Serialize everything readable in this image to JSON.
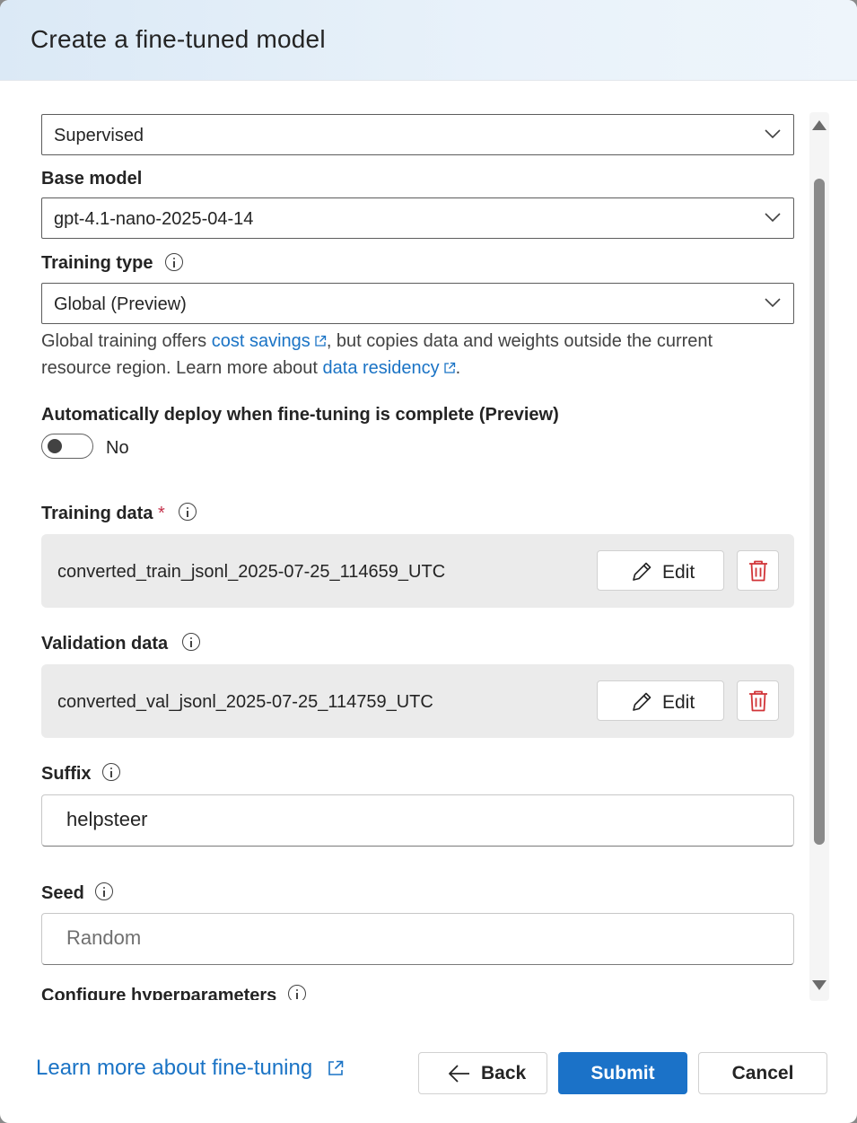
{
  "dialog": {
    "title": "Create a fine-tuned model"
  },
  "method": {
    "value": "Supervised"
  },
  "base_model": {
    "label": "Base model",
    "value": "gpt-4.1-nano-2025-04-14"
  },
  "training_type": {
    "label": "Training type",
    "value": "Global (Preview)",
    "help_before": "Global training offers ",
    "help_link1": "cost savings",
    "help_middle": ", but copies data and weights outside the current resource region. Learn more about ",
    "help_link2": "data residency",
    "help_end": "."
  },
  "auto_deploy": {
    "label": "Automatically deploy when fine-tuning is complete (Preview)",
    "state_label": "No"
  },
  "training_data": {
    "label": "Training data",
    "required_mark": "*",
    "file": "converted_train_jsonl_2025-07-25_114659_UTC",
    "edit_label": "Edit"
  },
  "validation_data": {
    "label": "Validation data",
    "file": "converted_val_jsonl_2025-07-25_114759_UTC",
    "edit_label": "Edit"
  },
  "suffix": {
    "label": "Suffix",
    "value": "helpsteer"
  },
  "seed": {
    "label": "Seed",
    "placeholder": "Random"
  },
  "hyperparameters": {
    "label": "Configure hyperparameters"
  },
  "footer": {
    "learn_more": "Learn more about fine-tuning",
    "back_label": "Back",
    "submit_label": "Submit",
    "cancel_label": "Cancel"
  },
  "colors": {
    "accent": "#1b72c8",
    "link": "#1a73c5",
    "required": "#c4314b",
    "delete": "#d13438"
  }
}
